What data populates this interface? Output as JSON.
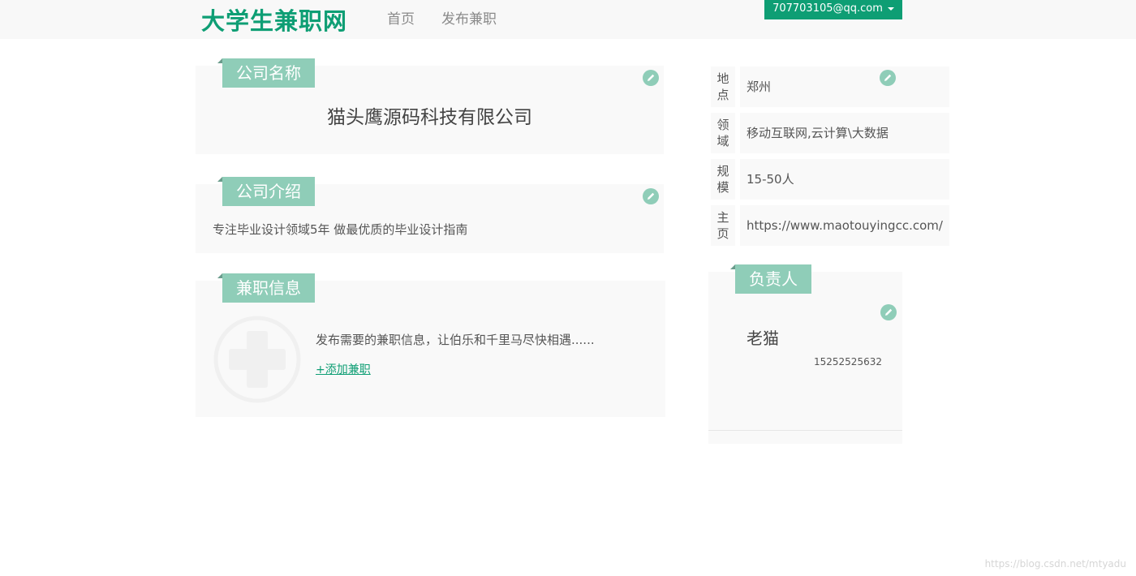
{
  "header": {
    "brand": "大学生兼职网",
    "nav": {
      "home": "首页",
      "post_job": "发布兼职"
    },
    "user_email": "707703105@qq.com"
  },
  "company_name_panel": {
    "tag": "公司名称",
    "value": "猫头鹰源码科技有限公司"
  },
  "company_intro_panel": {
    "tag": "公司介绍",
    "value": "专注毕业设计领域5年 做最优质的毕业设计指南"
  },
  "jobs_panel": {
    "tag": "兼职信息",
    "description": "发布需要的兼职信息，让伯乐和千里马尽快相遇......",
    "add_link": "+添加兼职"
  },
  "info": {
    "location": {
      "label_1": "地",
      "label_2": "点",
      "value": "郑州"
    },
    "field": {
      "label_1": "领",
      "label_2": "域",
      "value": "移动互联网,云计算\\大数据"
    },
    "size": {
      "label_1": "规",
      "label_2": "模",
      "value": "15-50人"
    },
    "homepage": {
      "label_1": "主",
      "label_2": "页",
      "value": "https://www.maotouyingcc.com/"
    }
  },
  "contact_panel": {
    "tag": "负责人",
    "name": "老猫",
    "phone": "15252525632"
  },
  "watermark": "https://blog.csdn.net/mtyadu",
  "colors": {
    "brand": "#0e9e74",
    "tag": "#8fcdb8",
    "panel_bg": "#f9f9f9",
    "header_bg": "#f8f8f8"
  },
  "icons": {
    "edit": "pencil-icon",
    "add": "plus-circle-icon",
    "dropdown": "caret-down-icon"
  }
}
